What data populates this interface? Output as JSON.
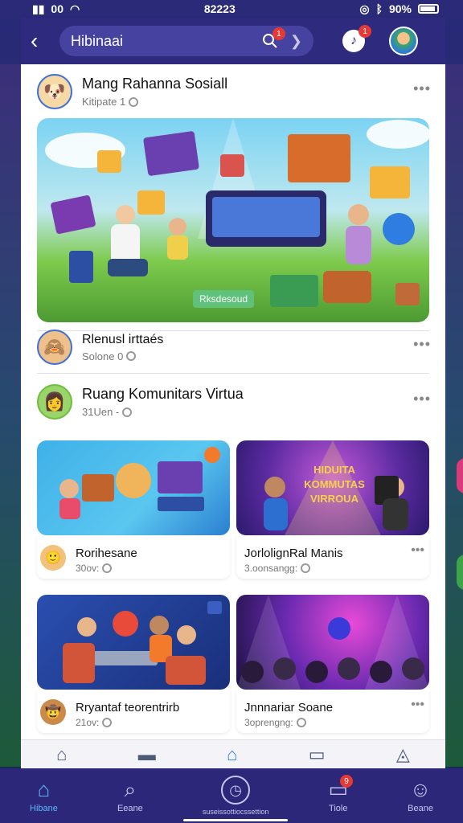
{
  "status": {
    "time": "82223",
    "left_text": "00",
    "battery": "90%"
  },
  "header": {
    "search_value": "Hibinaai",
    "search_badge": "1",
    "notif_badge": "1"
  },
  "posts": [
    {
      "title": "Mang Rahanna Sosiall",
      "meta": "Kitipate 1"
    },
    {
      "title": "Rlenusl irttaés",
      "meta": "Solone 0"
    },
    {
      "title": "Ruang Komunitars Virtua",
      "meta": "31Uen -"
    }
  ],
  "hero": {
    "badge": "Rksdesoud"
  },
  "cards": [
    {
      "title": "Rorihesane",
      "meta": "30ov:",
      "overlay": ""
    },
    {
      "title": "JorlolignRal Manis",
      "meta": "3.oonsangg:",
      "overlay": "HIDUITA KOMMUTAS VIRROUA"
    },
    {
      "title": "Rryantaf teorentrirb",
      "meta": "21ov:",
      "overlay": ""
    },
    {
      "title": "Jnnnariar Soane",
      "meta": "3oprengng:",
      "overlay": ""
    }
  ],
  "bottom_nav": [
    {
      "label": "Hibane",
      "icon": "home-icon"
    },
    {
      "label": "Eeane",
      "icon": "search-icon"
    },
    {
      "label": "suseissottiocssettion",
      "icon": "clock-icon"
    },
    {
      "label": "Tiole",
      "icon": "inbox-icon",
      "badge": "9"
    },
    {
      "label": "Beane",
      "icon": "profile-icon"
    }
  ],
  "colors": {
    "header": "#2e2b7e",
    "bottom_nav": "#2c2778",
    "active": "#5ab8ff",
    "badge": "#e53935"
  }
}
